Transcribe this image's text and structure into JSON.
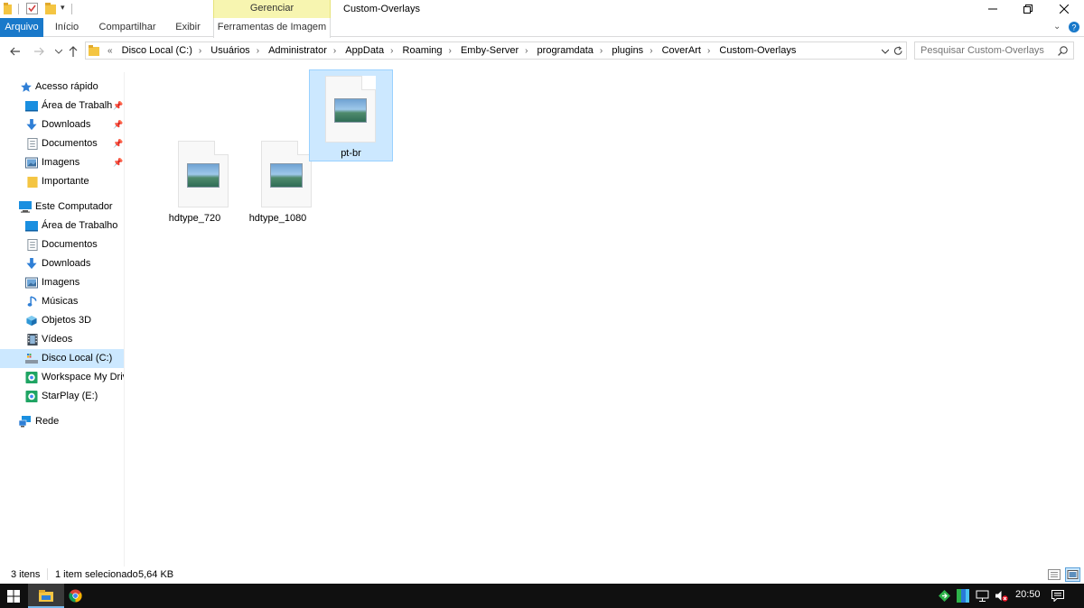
{
  "window": {
    "title": "Custom-Overlays",
    "contextual_group": "Gerenciar"
  },
  "ribbon": {
    "tabs": [
      "Arquivo",
      "Início",
      "Compartilhar",
      "Exibir",
      "Ferramentas de Imagem"
    ]
  },
  "address": {
    "overflow": "«",
    "crumbs": [
      "Disco Local (C:)",
      "Usuários",
      "Administrator",
      "AppData",
      "Roaming",
      "Emby-Server",
      "programdata",
      "plugins",
      "CoverArt",
      "Custom-Overlays"
    ]
  },
  "search": {
    "placeholder": "Pesquisar Custom-Overlays"
  },
  "nav": {
    "quick_access": "Acesso rápido",
    "quick_items": [
      "Área de Trabalho",
      "Downloads",
      "Documentos",
      "Imagens",
      "Importante"
    ],
    "this_pc": "Este Computador",
    "pc_items": [
      "Área de Trabalho",
      "Documentos",
      "Downloads",
      "Imagens",
      "Músicas",
      "Objetos 3D",
      "Vídeos",
      "Disco Local (C:)",
      "Workspace My Drive",
      "StarPlay (E:)"
    ],
    "network": "Rede"
  },
  "files": [
    {
      "name": "hdtype_720",
      "selected": false
    },
    {
      "name": "hdtype_1080",
      "selected": false
    },
    {
      "name": "pt-br",
      "selected": true
    }
  ],
  "status": {
    "count": "3 itens",
    "selection": "1 item selecionado",
    "size": "5,64 KB"
  },
  "taskbar": {
    "time": "20:50"
  },
  "colors": {
    "accent": "#1979ca",
    "selection": "#cce8ff",
    "contextual": "#f7f5b0",
    "taskbar": "#101010"
  }
}
